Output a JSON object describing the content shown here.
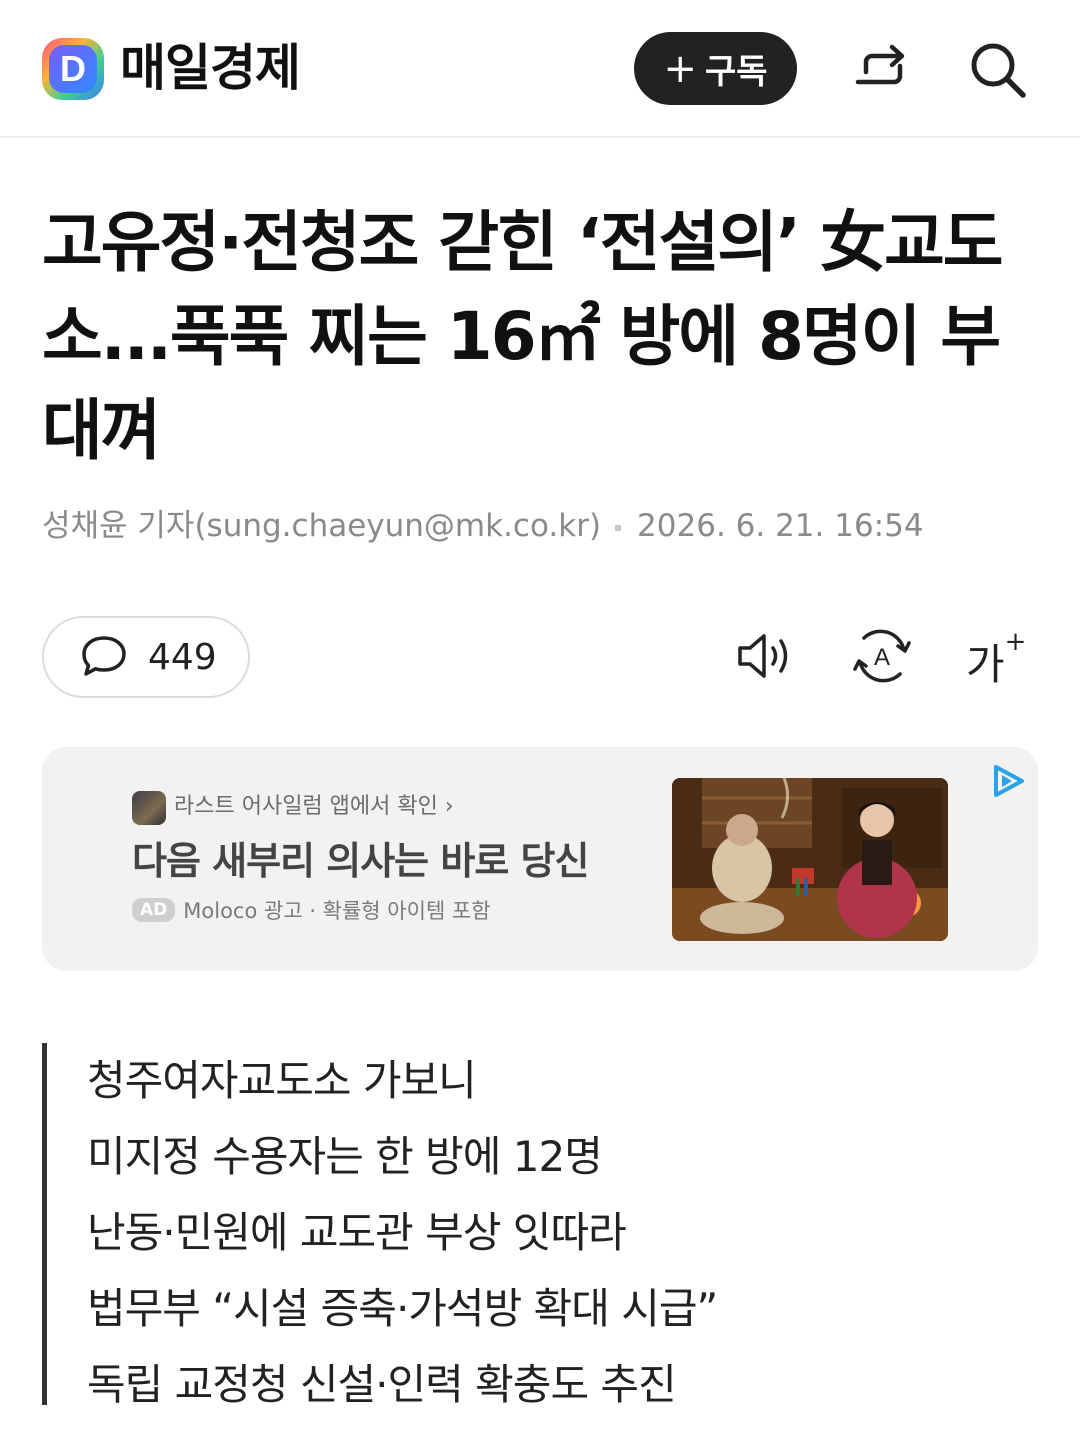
{
  "header": {
    "logo_letter": "D",
    "press_name": "매일경제",
    "subscribe_label": "구독",
    "subscribe_icon": "plus-icon",
    "share_icon": "share-icon",
    "search_icon": "search-icon"
  },
  "article": {
    "headline": "고유정·전청조 갇힌 ‘전설의’ 女교도소...푹푹 찌는 16㎡ 방에 8명이 부대껴",
    "byline": "성채윤 기자(sung.chaeyun@mk.co.kr)",
    "date": "2026. 6. 21. 16:54",
    "comment_count": "449",
    "tools": [
      "speaker-icon",
      "translate-icon",
      "font-size-icon"
    ],
    "font_size_label": "가"
  },
  "ad": {
    "source": "라스트 어사일럼 앱에서 확인 ›",
    "title": "다음 새부리 의사는 바로 당신",
    "badge": "AD",
    "meta": "Moloco 광고 · 확률형 아이템 포함",
    "image_icon": "ad-image"
  },
  "summary": [
    "청주여자교도소 가보니",
    "미지정 수용자는 한 방에 12명",
    "난동·민원에 교도관 부상 잇따라",
    "법무부 “시설 증축·가석방 확대 시급”",
    "독립 교정청 신설·인력 확충도 추진"
  ]
}
